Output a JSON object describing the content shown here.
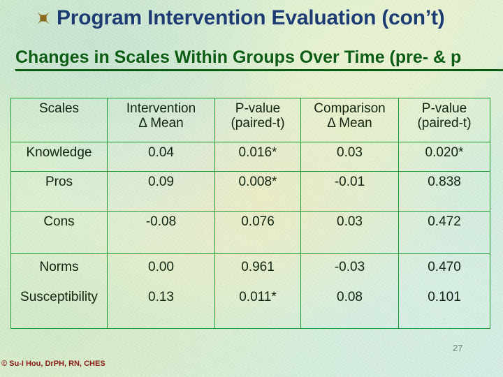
{
  "slide": {
    "title": "Program Intervention Evaluation (con’t)",
    "title_bullet_icon": "maltese-cross-bullet-icon",
    "title_color": "#1c3c72",
    "subtitle": "Changes in Scales Within Groups Over Time (pre- & p",
    "subtitle_color": "#0c5c14",
    "page_number": "27",
    "copyright": "© Su-I Hou, DrPH, RN, CHES",
    "copyright_color": "#8e1b1b",
    "background_color": "#cfe8c6",
    "table_border_color": "#1e9a34"
  },
  "table": {
    "headers": [
      {
        "line1": "Scales",
        "line2": ""
      },
      {
        "line1": "Intervention",
        "line2": "Δ Mean"
      },
      {
        "line1": "P-value",
        "line2": "(paired-t)"
      },
      {
        "line1": "Comparison",
        "line2": "Δ Mean"
      },
      {
        "line1": "P-value",
        "line2": "(paired-t)"
      }
    ],
    "rows": [
      {
        "scale": "Knowledge",
        "intervention_mean": "0.04",
        "intervention_p": "0.016*",
        "comparison_mean": "0.03",
        "comparison_p": "0.020*"
      },
      {
        "scale": "Pros",
        "intervention_mean": "0.09",
        "intervention_p": "0.008*",
        "comparison_mean": "-0.01",
        "comparison_p": "0.838"
      },
      {
        "scale": "Cons",
        "intervention_mean": "-0.08",
        "intervention_p": "0.076",
        "comparison_mean": "0.03",
        "comparison_p": "0.472"
      },
      {
        "scale": "Norms",
        "intervention_mean": "0.00",
        "intervention_p": "0.961",
        "comparison_mean": "-0.03",
        "comparison_p": "0.470"
      },
      {
        "scale": "Susceptibility",
        "intervention_mean": "0.13",
        "intervention_p": "0.011*",
        "comparison_mean": "0.08",
        "comparison_p": "0.101"
      }
    ]
  }
}
